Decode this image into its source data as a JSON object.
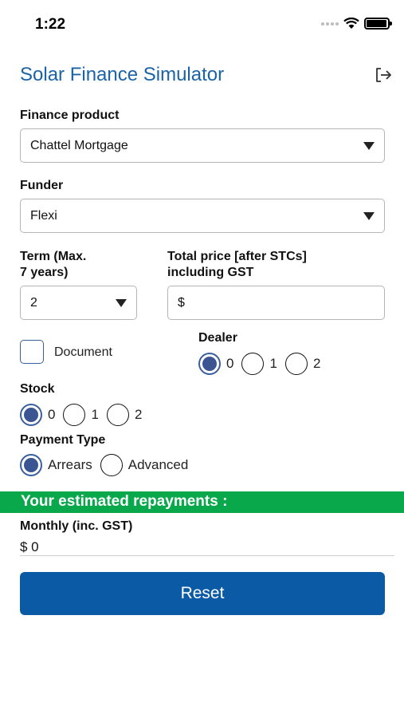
{
  "status_bar": {
    "time": "1:22"
  },
  "header": {
    "title": "Solar Finance Simulator",
    "logout_icon": "logout-icon"
  },
  "finance_product": {
    "label": "Finance product",
    "value": "Chattel Mortgage"
  },
  "funder": {
    "label": "Funder",
    "value": "Flexi"
  },
  "term": {
    "label_line1": "Term (Max.",
    "label_line2": "7 years)",
    "value": "2"
  },
  "total_price": {
    "label_line1": "Total price [after STCs]",
    "label_line2": "including GST",
    "prefix": "$",
    "value": ""
  },
  "document": {
    "label": "Document",
    "checked": false
  },
  "dealer": {
    "label": "Dealer",
    "options": [
      "0",
      "1",
      "2"
    ],
    "selected": "0"
  },
  "stock": {
    "label": "Stock",
    "options": [
      "0",
      "1",
      "2"
    ],
    "selected": "0"
  },
  "payment_type": {
    "label": "Payment Type",
    "options": [
      "Arrears",
      "Advanced"
    ],
    "selected": "Arrears"
  },
  "repayments": {
    "banner": "Your estimated repayments :",
    "monthly_label": "Monthly (inc. GST)",
    "monthly_value": "$ 0"
  },
  "reset_button": {
    "label": "Reset"
  },
  "colors": {
    "title": "#1a63a8",
    "banner": "#08a84b",
    "button": "#0b5aa5",
    "radio_selected": "#3b5593"
  }
}
